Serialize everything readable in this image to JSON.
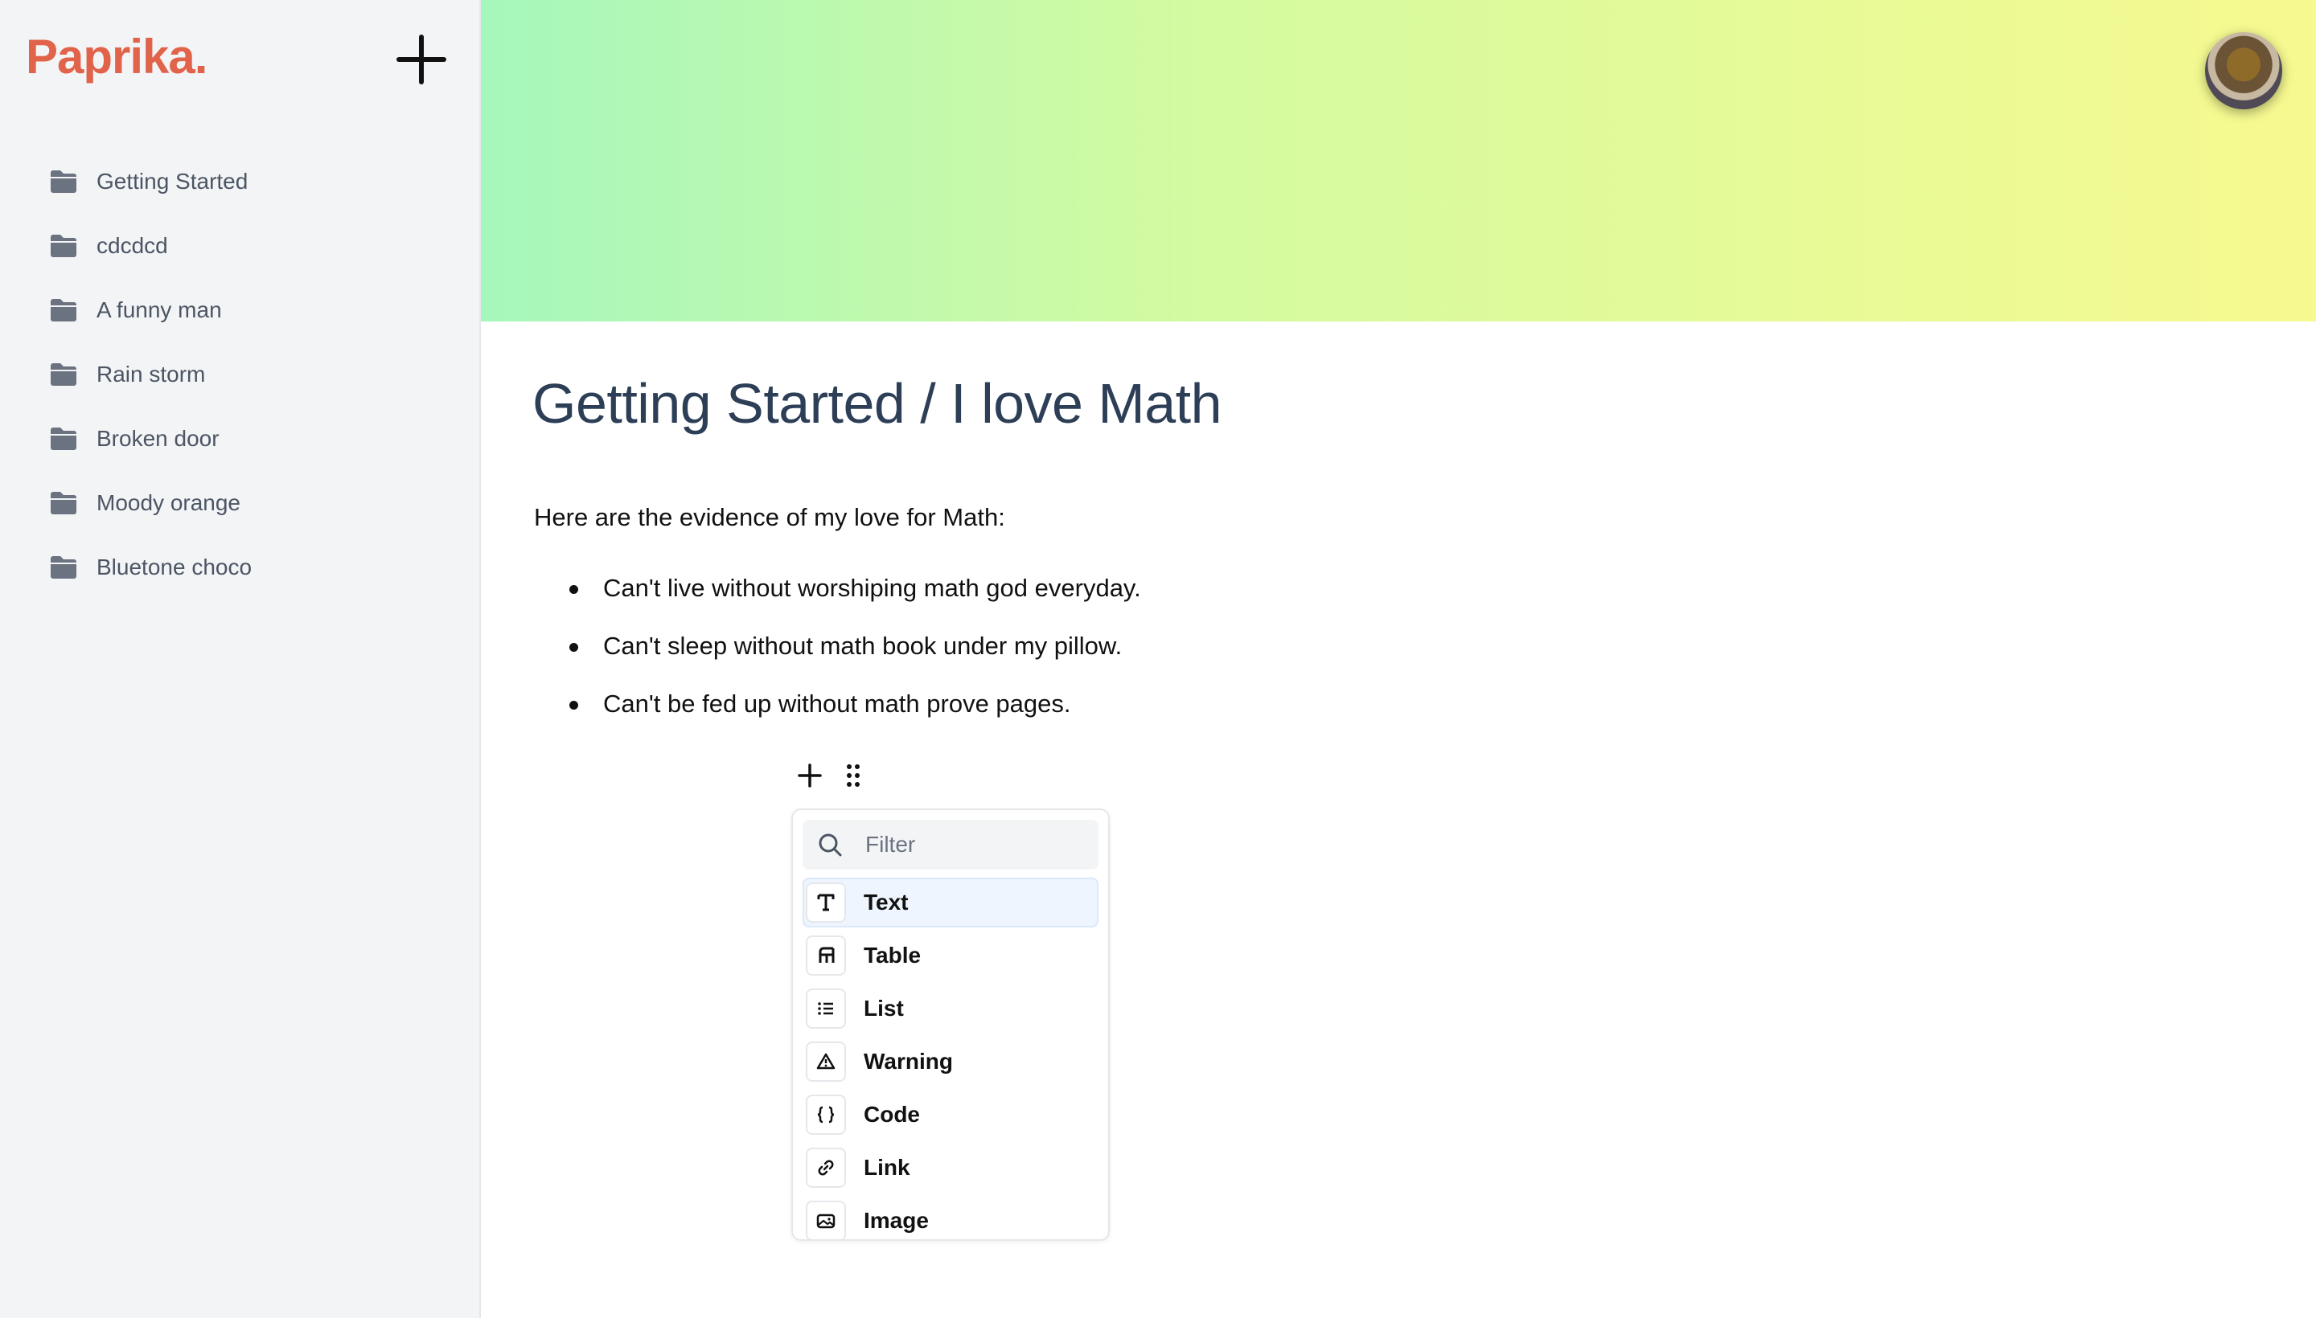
{
  "app": {
    "logo": "Paprika."
  },
  "sidebar": {
    "items": [
      {
        "label": "Getting Started"
      },
      {
        "label": "cdcdcd"
      },
      {
        "label": "A funny man"
      },
      {
        "label": "Rain storm"
      },
      {
        "label": "Broken door"
      },
      {
        "label": "Moody orange"
      },
      {
        "label": "Bluetone choco"
      }
    ]
  },
  "page": {
    "title": "Getting Started / I love Math",
    "intro": "Here are the evidence of my love for Math:",
    "bullets": [
      "Can't live without worshiping math god everyday.",
      "Can't sleep without math book under my pillow.",
      "Can't be fed up without math prove pages."
    ]
  },
  "block_menu": {
    "filter_placeholder": "Filter",
    "items": [
      {
        "label": "Text",
        "icon": "text-icon",
        "active": true
      },
      {
        "label": "Table",
        "icon": "table-icon"
      },
      {
        "label": "List",
        "icon": "list-icon"
      },
      {
        "label": "Warning",
        "icon": "warning-icon"
      },
      {
        "label": "Code",
        "icon": "code-icon"
      },
      {
        "label": "Link",
        "icon": "link-icon"
      },
      {
        "label": "Image",
        "icon": "image-icon"
      }
    ]
  },
  "colors": {
    "logo": "#e0634a",
    "title": "#2d3e57",
    "sidebar_bg": "#f3f4f6",
    "banner_start": "#a6f7bc",
    "banner_end": "#f7f98f",
    "active_item_bg": "#eef5fe"
  }
}
